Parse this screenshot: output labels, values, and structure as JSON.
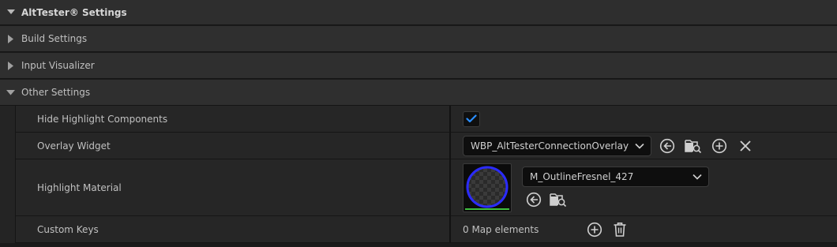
{
  "section": {
    "title": "AltTester® Settings"
  },
  "categories": [
    {
      "label": "Build Settings",
      "expanded": false
    },
    {
      "label": "Input Visualizer",
      "expanded": false
    },
    {
      "label": "Other Settings",
      "expanded": true
    }
  ],
  "properties": {
    "hide_highlight": {
      "label": "Hide Highlight Components",
      "checked": true
    },
    "overlay_widget": {
      "label": "Overlay Widget",
      "value": "WBP_AltTesterConnectionOverlay"
    },
    "highlight_material": {
      "label": "Highlight Material",
      "value": "M_OutlineFresnel_427"
    },
    "custom_keys": {
      "label": "Custom Keys",
      "value": "0 Map elements"
    }
  },
  "icons": {
    "expand": "triangle-right-icon",
    "collapse": "triangle-down-icon",
    "browse": "arrow-left-circle-icon",
    "find": "folder-search-icon",
    "add": "plus-circle-icon",
    "clear": "x-icon",
    "delete": "trash-icon",
    "check": "checkmark-icon",
    "dropdown": "chevron-down-icon"
  },
  "colors": {
    "accent_check": "#2a8fff",
    "thumb_ring": "#2b2bff",
    "thumb_underline": "#3fbf3f"
  }
}
